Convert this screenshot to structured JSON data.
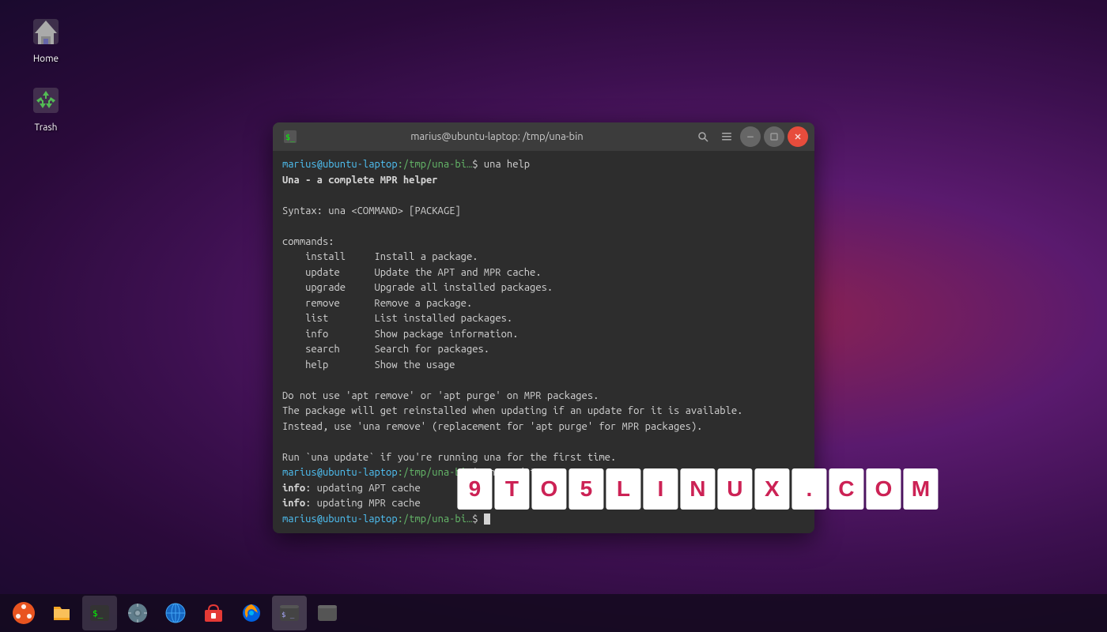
{
  "desktop": {
    "icons": [
      {
        "id": "home",
        "label": "Home",
        "type": "home"
      },
      {
        "id": "trash",
        "label": "Trash",
        "type": "trash"
      }
    ]
  },
  "terminal": {
    "title": "marius@ubuntu-laptop: /tmp/una-bin",
    "prompt_user": "marius@ubuntu-laptop",
    "prompt_path_1": ":/tmp/una-bi…",
    "prompt_path_2": ":/tmp/una-bi…",
    "prompt_path_3": ":/tmp/una-bi…",
    "lines": [
      {
        "type": "prompt_cmd",
        "prompt": "marius@ubuntu-laptop",
        "path": ":/tmp/una-bi…",
        "cmd": "$ una help"
      },
      {
        "type": "output",
        "text": "Una - a complete MPR helper"
      },
      {
        "type": "blank"
      },
      {
        "type": "output",
        "text": "Syntax: una <COMMAND> [PACKAGE]"
      },
      {
        "type": "blank"
      },
      {
        "type": "output",
        "text": "commands:"
      },
      {
        "type": "cmd_desc",
        "cmd": "  install",
        "desc": "  Install a package."
      },
      {
        "type": "cmd_desc",
        "cmd": "  update",
        "desc": "   Update the APT and MPR cache."
      },
      {
        "type": "cmd_desc",
        "cmd": "  upgrade",
        "desc": "  Upgrade all installed packages."
      },
      {
        "type": "cmd_desc",
        "cmd": "  remove",
        "desc": "   Remove a package."
      },
      {
        "type": "cmd_desc",
        "cmd": "  list",
        "desc": "     List installed packages."
      },
      {
        "type": "cmd_desc",
        "cmd": "  info",
        "desc": "     Show package information."
      },
      {
        "type": "cmd_desc",
        "cmd": "  search",
        "desc": "   Search for packages."
      },
      {
        "type": "cmd_desc",
        "cmd": "  help",
        "desc": "     Show the usage"
      },
      {
        "type": "blank"
      },
      {
        "type": "output",
        "text": "Do not use 'apt remove' or 'apt purge' on MPR packages."
      },
      {
        "type": "output",
        "text": "The package will get reinstalled when updating if an update for it is available."
      },
      {
        "type": "output",
        "text": "Instead, use 'una remove' (replacement for 'apt purge' for MPR packages)."
      },
      {
        "type": "blank"
      },
      {
        "type": "output",
        "text": "Run `una update` if you're running una for the first time."
      },
      {
        "type": "prompt_cmd",
        "prompt": "marius@ubuntu-laptop",
        "path": ":/tmp/una-bi…",
        "cmd": "$ una update"
      },
      {
        "type": "output",
        "text": "info: updating APT cache"
      },
      {
        "type": "output",
        "text": "info: updating MPR cache"
      },
      {
        "type": "prompt_cursor",
        "prompt": "marius@ubuntu-laptop",
        "path": ":/tmp/una-bi…"
      }
    ]
  },
  "watermark": {
    "text": "9TO5LINUX.COM",
    "chars": [
      "9",
      "T",
      "O",
      "5",
      "L",
      "I",
      "N",
      "U",
      "X",
      ".",
      "C",
      "O",
      "M"
    ]
  },
  "taskbar": {
    "items": [
      {
        "id": "start",
        "label": "Start",
        "type": "ubuntu"
      },
      {
        "id": "files",
        "label": "Files",
        "type": "files"
      },
      {
        "id": "terminal",
        "label": "Terminal",
        "type": "terminal",
        "active": true
      },
      {
        "id": "settings",
        "label": "Settings",
        "type": "settings"
      },
      {
        "id": "browser",
        "label": "Browser",
        "type": "browser"
      },
      {
        "id": "store",
        "label": "Store",
        "type": "store"
      },
      {
        "id": "firefox",
        "label": "Firefox",
        "type": "firefox"
      },
      {
        "id": "terminal2",
        "label": "Terminal 2",
        "type": "terminal2",
        "active": true
      },
      {
        "id": "terminal3",
        "label": "Terminal 3",
        "type": "terminal3"
      }
    ]
  }
}
